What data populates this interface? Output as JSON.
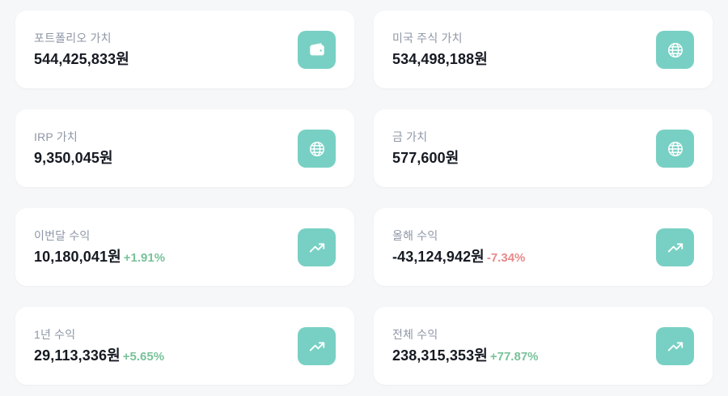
{
  "colors": {
    "background": "#f6f7f9",
    "card": "#ffffff",
    "icon_bg": "#78d0c4",
    "label": "#8e97a6",
    "value": "#161a22",
    "positive": "#79c29a",
    "negative": "#e88a8a"
  },
  "cards": [
    {
      "label": "포트폴리오 가치",
      "value": "544,425,833원",
      "change": "",
      "icon": "wallet-icon"
    },
    {
      "label": "미국 주식 가치",
      "value": "534,498,188원",
      "change": "",
      "icon": "globe-icon"
    },
    {
      "label": "IRP 가치",
      "value": "9,350,045원",
      "change": "",
      "icon": "globe-icon"
    },
    {
      "label": "금 가치",
      "value": "577,600원",
      "change": "",
      "icon": "globe-icon"
    },
    {
      "label": "이번달 수익",
      "value": "10,180,041원",
      "change": "+1.91%",
      "icon": "trending-up-icon"
    },
    {
      "label": "올해 수익",
      "value": "-43,124,942원",
      "change": "-7.34%",
      "icon": "trending-up-icon"
    },
    {
      "label": "1년 수익",
      "value": "29,113,336원",
      "change": "+5.65%",
      "icon": "trending-up-icon"
    },
    {
      "label": "전체 수익",
      "value": "238,315,353원",
      "change": "+77.87%",
      "icon": "trending-up-icon"
    }
  ]
}
